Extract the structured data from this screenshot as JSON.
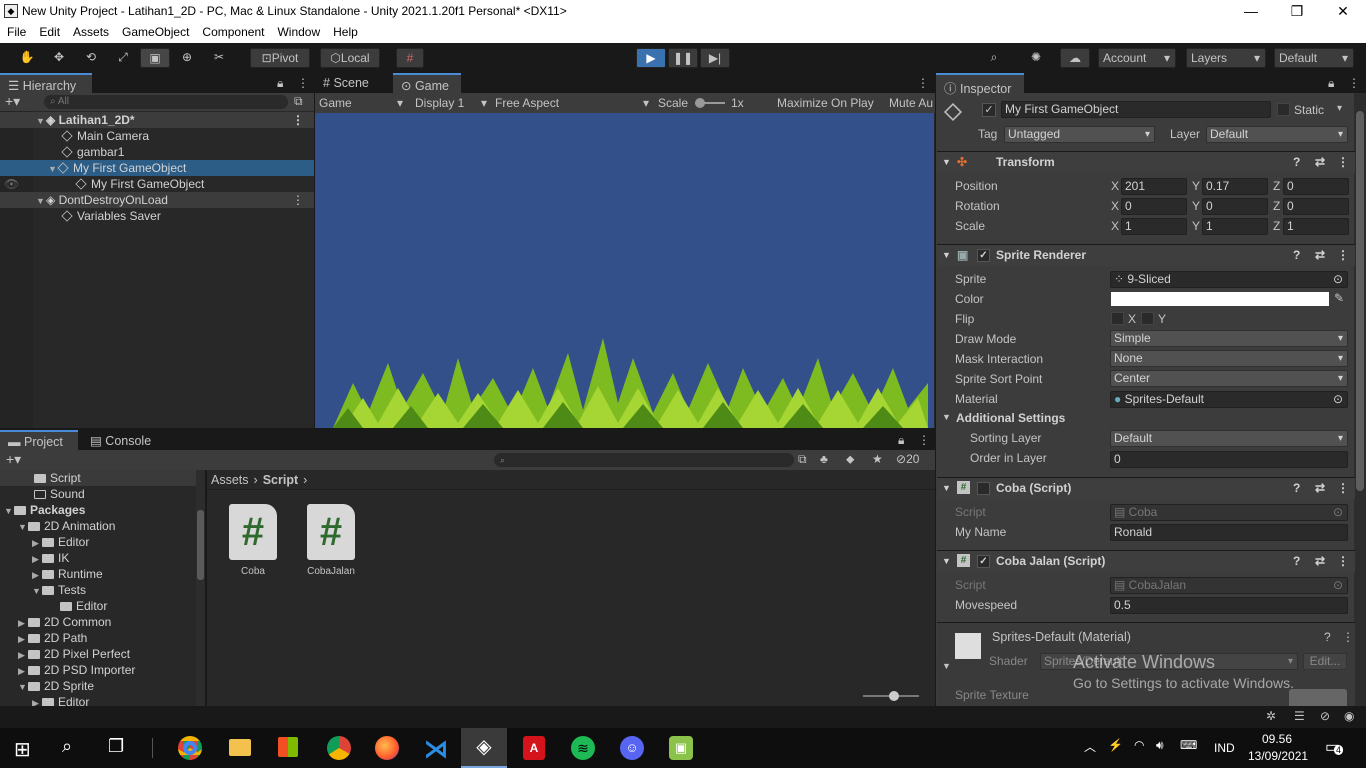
{
  "window": {
    "title": "New Unity Project - Latihan1_2D - PC, Mac & Linux Standalone - Unity 2021.1.20f1 Personal* <DX11>"
  },
  "menu": [
    "File",
    "Edit",
    "Assets",
    "GameObject",
    "Component",
    "Window",
    "Help"
  ],
  "toolbar": {
    "pivot": "Pivot",
    "local": "Local",
    "account": "Account",
    "layers": "Layers",
    "layout": "Default"
  },
  "hierarchy": {
    "tab": "Hierarchy",
    "search_placeholder": "All",
    "items": [
      {
        "label": "Latihan1_2D*"
      },
      {
        "label": "Main Camera"
      },
      {
        "label": "gambar1"
      },
      {
        "label": "My First GameObject"
      },
      {
        "label": "My First GameObject"
      },
      {
        "label": "DontDestroyOnLoad"
      },
      {
        "label": "Variables Saver"
      }
    ]
  },
  "game": {
    "tabs": [
      "Scene",
      "Game"
    ],
    "mode": "Game",
    "display": "Display 1",
    "aspect": "Free Aspect",
    "scale_label": "Scale",
    "scale_value": "1x",
    "maximize": "Maximize On Play",
    "mute": "Mute Au",
    "bg_color": "#34508a"
  },
  "project": {
    "tabs": [
      "Project",
      "Console"
    ],
    "hidden_count": "20",
    "breadcrumb": [
      "Assets",
      "Script"
    ],
    "tree": [
      {
        "label": "Script"
      },
      {
        "label": "Sound"
      },
      {
        "label": "Packages"
      },
      {
        "label": "2D Animation"
      },
      {
        "label": "Editor"
      },
      {
        "label": "IK"
      },
      {
        "label": "Runtime"
      },
      {
        "label": "Tests"
      },
      {
        "label": "Editor"
      },
      {
        "label": "2D Common"
      },
      {
        "label": "2D Path"
      },
      {
        "label": "2D Pixel Perfect"
      },
      {
        "label": "2D PSD Importer"
      },
      {
        "label": "2D Sprite"
      },
      {
        "label": "Editor"
      }
    ],
    "assets": [
      {
        "name": "Coba"
      },
      {
        "name": "CobaJalan"
      }
    ]
  },
  "inspector": {
    "tab": "Inspector",
    "object_name": "My First GameObject",
    "static_label": "Static",
    "tag_label": "Tag",
    "tag": "Untagged",
    "layer_label": "Layer",
    "layer": "Default",
    "transform": {
      "title": "Transform",
      "position": {
        "label": "Position",
        "x": "201",
        "y": "0.17",
        "z": "0"
      },
      "rotation": {
        "label": "Rotation",
        "x": "0",
        "y": "0",
        "z": "0"
      },
      "scale": {
        "label": "Scale",
        "x": "1",
        "y": "1",
        "z": "1"
      }
    },
    "sprite_renderer": {
      "title": "Sprite Renderer",
      "sprite_label": "Sprite",
      "sprite": "9-Sliced",
      "color_label": "Color",
      "flip_label": "Flip",
      "flip_x": "X",
      "flip_y": "Y",
      "draw_mode_label": "Draw Mode",
      "draw_mode": "Simple",
      "mask_label": "Mask Interaction",
      "mask": "None",
      "sort_point_label": "Sprite Sort Point",
      "sort_point": "Center",
      "material_label": "Material",
      "material": "Sprites-Default",
      "additional": "Additional Settings",
      "sorting_layer_label": "Sorting Layer",
      "sorting_layer": "Default",
      "order_label": "Order in Layer",
      "order": "0"
    },
    "coba": {
      "title": "Coba (Script)",
      "script_label": "Script",
      "script": "Coba",
      "name_label": "My Name",
      "name": "Ronald"
    },
    "coba_jalan": {
      "title": "Coba Jalan (Script)",
      "script_label": "Script",
      "script": "CobaJalan",
      "speed_label": "Movespeed",
      "speed": "0.5"
    },
    "material": {
      "title": "Sprites-Default (Material)",
      "shader_label": "Shader",
      "shader": "Sprites/Default",
      "edit": "Edit...",
      "texture_label": "Sprite Texture"
    }
  },
  "watermark": {
    "line1": "Activate Windows",
    "line2": "Go to Settings to activate Windows."
  },
  "taskbar": {
    "lang": "IND",
    "time": "09.56",
    "date": "13/09/2021",
    "notif": "4"
  }
}
